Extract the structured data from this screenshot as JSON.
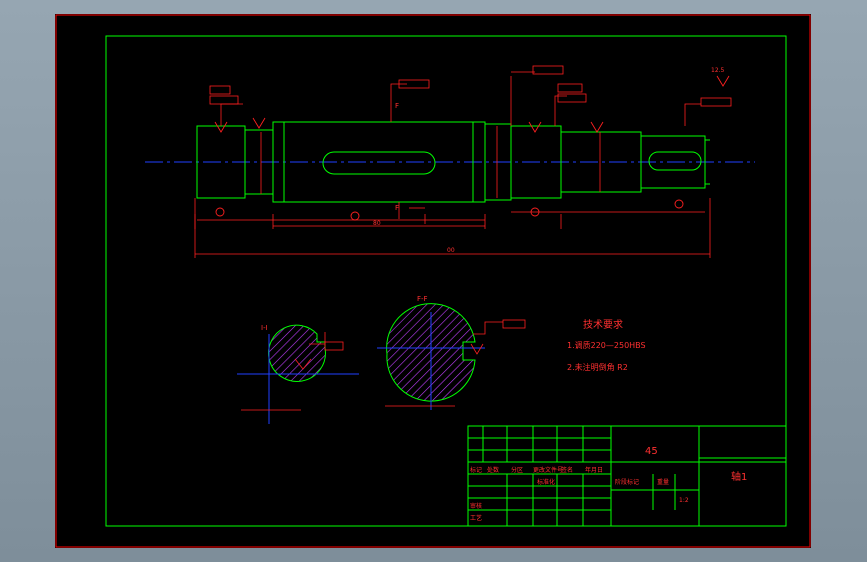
{
  "drawing": {
    "tech_req_title": "技术要求",
    "tech_req_items": [
      "1.调质220—250HBS",
      "2.未注明倒角 R2"
    ],
    "section_labels": {
      "left": "I-I",
      "right": "F-F"
    },
    "cut_marks": {
      "top": "F",
      "bottom": "F"
    },
    "roughness_mark": "12.5",
    "dims": {
      "keyway_len": "80",
      "overall_len": "00",
      "mid_len": "80"
    }
  },
  "title_block": {
    "material": "45",
    "part_name": "轴1",
    "scale": "1:2",
    "labels": {
      "mark": "标记",
      "count": "处数",
      "zone": "分区",
      "change_doc": "更改文件号",
      "signature": "签名",
      "date": "年月日",
      "standardization": "标准化",
      "stage_mark": "阶段标记",
      "weight": "重量",
      "process": "工艺",
      "review": "审核"
    }
  },
  "colors": {
    "background": "#000000",
    "frame": "#00ff00",
    "part": "#00ff00",
    "dimension": "#ff2020",
    "centerline": "#2040ff",
    "hatch": "#c040ff",
    "text": "#ff3030",
    "outer_border": "#ff0000"
  }
}
